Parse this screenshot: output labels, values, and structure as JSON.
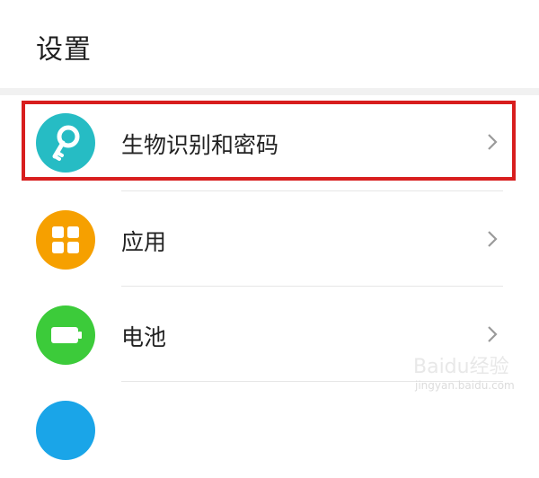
{
  "header": {
    "title": "设置"
  },
  "items": [
    {
      "label": "生物识别和密码",
      "icon": "key-icon",
      "color": "#26bcc4"
    },
    {
      "label": "应用",
      "icon": "apps-grid-icon",
      "color": "#f6a000"
    },
    {
      "label": "电池",
      "icon": "battery-icon",
      "color": "#3ccb3a"
    },
    {
      "label": "",
      "icon": "partial-item-icon",
      "color": "#1aa5e8"
    }
  ],
  "highlight_color": "#d81e1e",
  "watermark": {
    "text": "Baidu经验",
    "sub": "jingyan.baidu.com"
  }
}
